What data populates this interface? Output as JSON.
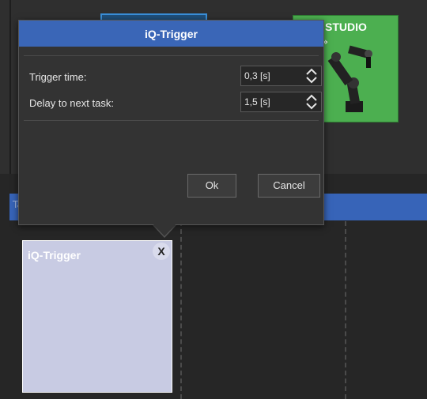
{
  "background": {
    "card_blue_text": "",
    "card_green": {
      "title": "STUDIO",
      "subtitle": "u...»"
    },
    "tasks_section_label": "Tasks"
  },
  "dialog": {
    "title": "iQ-Trigger",
    "rows": [
      {
        "label": "Trigger time:",
        "value": "0,3 [s]"
      },
      {
        "label": "Delay to next task:",
        "value": "1,5 [s]"
      }
    ],
    "ok_label": "Ok",
    "cancel_label": "Cancel"
  },
  "task_card": {
    "title": "iQ-Trigger",
    "close_glyph": "X"
  },
  "colors": {
    "dialog_header": "#3a66b7",
    "task_card": "#c8cbe3",
    "green_card": "#4caf50",
    "tasks_bar": "#3764b8"
  }
}
